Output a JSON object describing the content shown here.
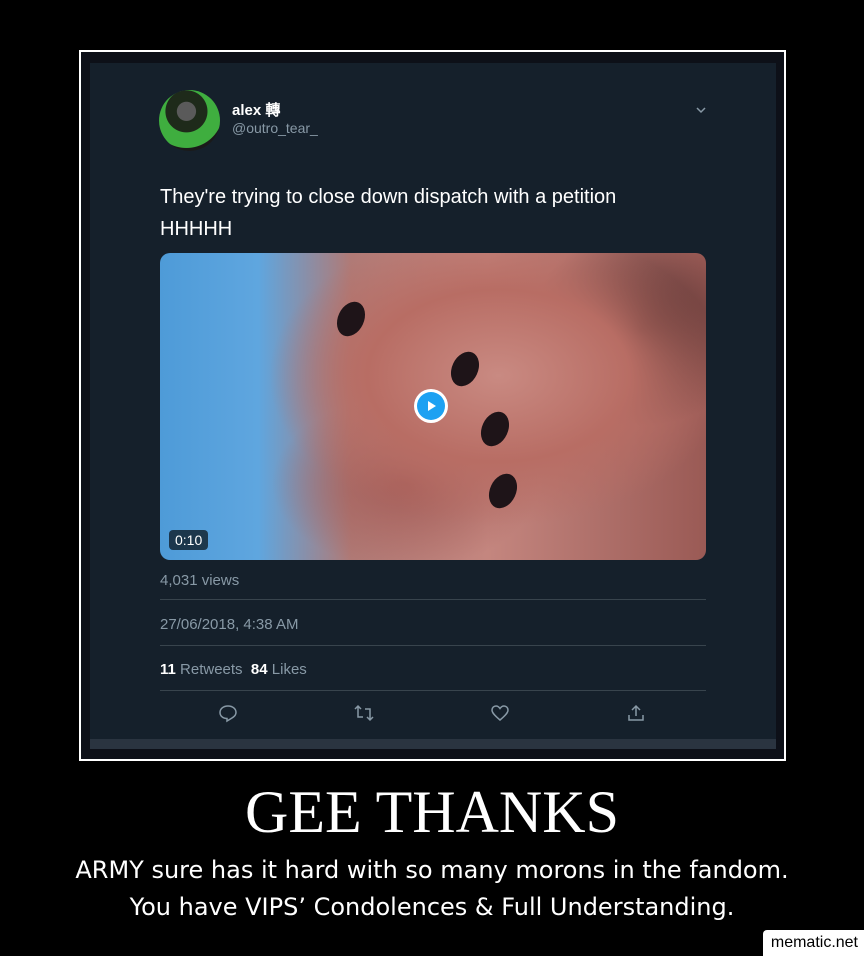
{
  "tweet": {
    "display_name": "alex 轉",
    "handle": "@outro_tear_",
    "text_line1": "They're trying to close down dispatch with a petition",
    "text_line2": "HHHHH",
    "video_duration": "0:10",
    "views": "4,031 views",
    "timestamp": "27/06/2018, 4:38 AM",
    "retweets_count": "11",
    "retweets_label": "Retweets",
    "likes_count": "84",
    "likes_label": "Likes"
  },
  "icons": {
    "menu": "chevron-down-icon",
    "play": "play-icon",
    "reply": "reply-icon",
    "retweet": "retweet-icon",
    "like": "heart-icon",
    "share": "share-icon"
  },
  "colors": {
    "background": "#15202b",
    "accent": "#1da1f2",
    "muted_text": "#8899a6"
  },
  "caption": {
    "title": "GEE THANKS",
    "line1": "ARMY sure has it hard with so many morons in the fandom.",
    "line2": "You have VIPS’ Condolences & Full Understanding."
  },
  "watermark": "mematic.net"
}
